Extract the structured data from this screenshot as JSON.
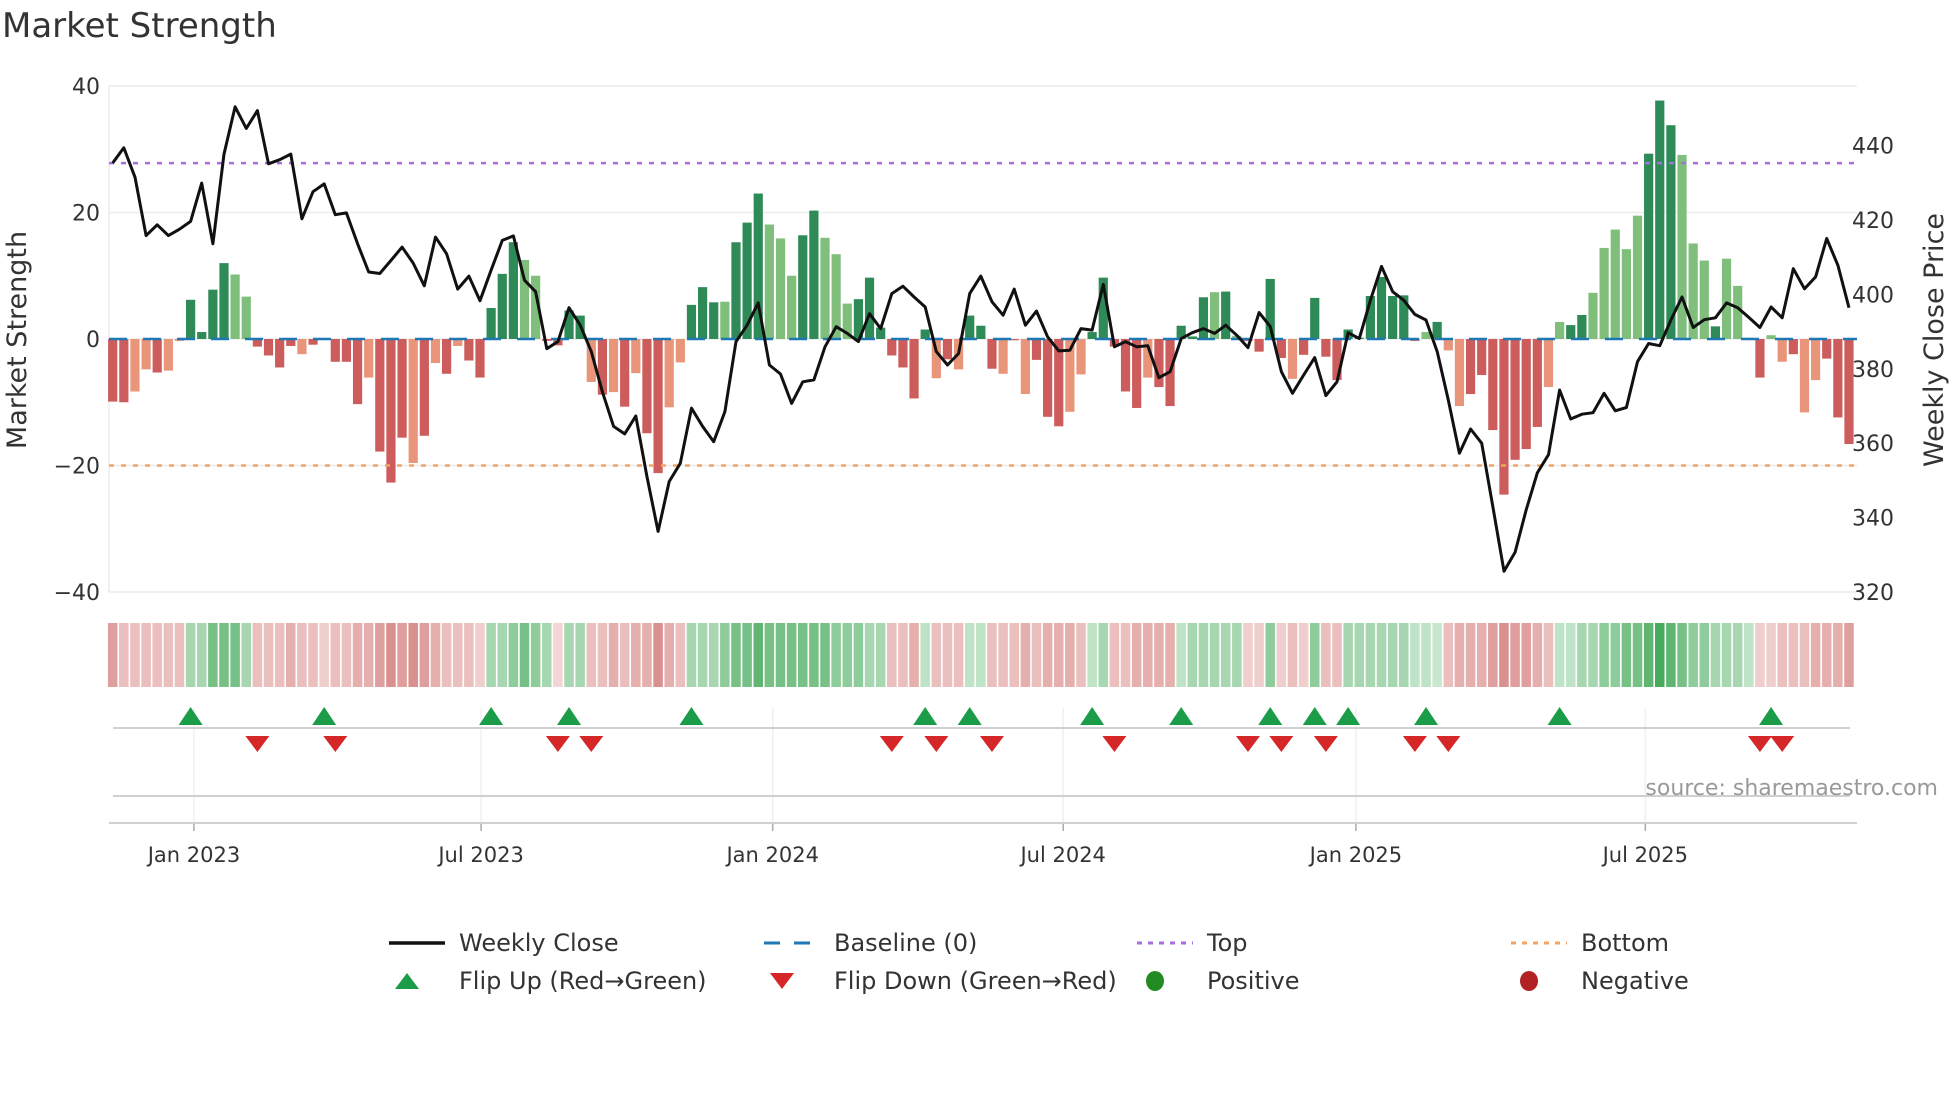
{
  "chart_data": {
    "type": "bar",
    "title": "Market Strength",
    "ylabel": "Market Strength",
    "y2label": "Weekly Close Price",
    "ylim": [
      -40,
      40
    ],
    "y2lim": [
      320,
      456
    ],
    "yticks": [
      "40",
      "20",
      "0",
      "−20",
      "−40"
    ],
    "ytick_values": [
      40,
      20,
      0,
      -20,
      -40
    ],
    "y2ticks": [
      440,
      420,
      400,
      380,
      360,
      340,
      320
    ],
    "top_level": 27.8,
    "bottom_level": -20,
    "baseline": 0,
    "x_ticks": [
      {
        "label": "Jan 2023",
        "week": 7.3
      },
      {
        "label": "Jul 2023",
        "week": 33.1
      },
      {
        "label": "Jan 2024",
        "week": 59.3
      },
      {
        "label": "Jul 2024",
        "week": 85.4
      },
      {
        "label": "Jan 2025",
        "week": 111.7
      },
      {
        "label": "Jul 2025",
        "week": 137.7
      }
    ],
    "strength": [
      -9.9,
      -10,
      -8.3,
      -4.8,
      -5.3,
      -5,
      -0.3,
      6.2,
      1.1,
      7.8,
      12,
      10.2,
      6.7,
      -1.2,
      -2.6,
      -4.5,
      -1.1,
      -2.4,
      -0.9,
      0.1,
      -3.6,
      -3.6,
      -10.3,
      -6.1,
      -17.8,
      -22.7,
      -15.6,
      -19.6,
      -15.3,
      -3.8,
      -5.5,
      -1.1,
      -3.4,
      -6.1,
      4.9,
      10.3,
      15.3,
      12.5,
      10,
      -0.3,
      -1,
      4.5,
      3.7,
      -6.8,
      -8.8,
      -8.4,
      -10.7,
      -5.4,
      -14.9,
      -21.2,
      -10.8,
      -3.7,
      5.4,
      8.2,
      5.8,
      5.9,
      15.3,
      18.4,
      23,
      18.1,
      15.9,
      10,
      16.4,
      20.3,
      16,
      13.4,
      5.6,
      6.3,
      9.7,
      1.8,
      -2.6,
      -4.5,
      -9.4,
      1.5,
      -6.2,
      -3.2,
      -4.8,
      3.7,
      2.1,
      -4.7,
      -5.5,
      -0.2,
      -8.7,
      -3.3,
      -12.3,
      -13.8,
      -11.5,
      -5.6,
      1.1,
      9.7,
      -1.2,
      -8.3,
      -10.9,
      -6.1,
      -7.6,
      -10.6,
      2.1,
      0.4,
      6.6,
      7.4,
      7.5,
      0.5,
      -0.3,
      -2,
      9.5,
      -3,
      -6.3,
      -2.5,
      6.5,
      -2.8,
      -6.5,
      1.5,
      0.2,
      6.8,
      9.8,
      6.8,
      6.9,
      -0.3,
      1.1,
      2.7,
      -1.8,
      -10.6,
      -8.7,
      -5.7,
      -14.4,
      -24.6,
      -19.1,
      -17.4,
      -13.9,
      -7.6,
      2.7,
      2.2,
      3.8,
      7.3,
      14.4,
      17.3,
      14.2,
      19.5,
      29.3,
      37.7,
      33.8,
      29.1,
      15.1,
      12.4,
      2,
      12.7,
      8.4,
      0.2,
      -6.1,
      0.6,
      -3.6,
      -2.4,
      -11.6,
      -6.5,
      -3.1,
      -12.4,
      -16.6
    ],
    "shade": "ddlldllddddllddddldldddldddldldldddddllddddldldlddlldddldddlllddllldddddddldldddldldddlldddddldddddldlddddldddddddddddldlldddddddllddllllldddllldllldlldllddddddldlllldd",
    "weekly_close": [
      435.3,
      439.4,
      431.5,
      415.8,
      418.7,
      415.8,
      417.5,
      419.6,
      429.9,
      413.6,
      437.7,
      450.4,
      444.6,
      449.4,
      435.1,
      436.2,
      437.7,
      420.3,
      427.6,
      429.7,
      421.4,
      421.9,
      413.6,
      406,
      405.6,
      409.1,
      412.7,
      408.4,
      402.3,
      415.4,
      410.9,
      401.4,
      404.9,
      398.3,
      406.5,
      414.5,
      415.7,
      403.8,
      400.7,
      385.4,
      387.3,
      396.4,
      391.7,
      384.6,
      373.8,
      364.5,
      362.5,
      367.3,
      351.1,
      336.3,
      349.7,
      354.6,
      369.4,
      364.5,
      360.4,
      368.5,
      387.3,
      391.7,
      397.7,
      381,
      378.6,
      370.7,
      376.5,
      377,
      385.9,
      391.3,
      389.5,
      387.3,
      394.8,
      390.8,
      400.2,
      402.2,
      399.3,
      396.6,
      384.6,
      381,
      384.1,
      400.2,
      404.9,
      398,
      394.4,
      401.4,
      391.7,
      395.5,
      388.6,
      384.8,
      385,
      390.8,
      390.4,
      402.7,
      385.9,
      387.3,
      385.9,
      386.2,
      377.6,
      379.2,
      388.1,
      389.7,
      390.8,
      389.5,
      391.7,
      389,
      385.7,
      395.1,
      391.4,
      379.2,
      373.4,
      378.3,
      383,
      372.8,
      376.5,
      389.7,
      388.1,
      398.4,
      407.5,
      400.7,
      398.4,
      394.6,
      393.1,
      384.6,
      371.6,
      357.3,
      363.8,
      360,
      343,
      325.6,
      330.7,
      342.1,
      352,
      356.9,
      374.3,
      366.5,
      367.8,
      368.2,
      373.4,
      368.7,
      369.6,
      381.9,
      386.8,
      386.2,
      393.1,
      399.3,
      391.1,
      393.2,
      393.7,
      397.7,
      396.4,
      393.8,
      391.1,
      396.6,
      393.7,
      406.9,
      401.5,
      404.7,
      415,
      407.8,
      396.4
    ],
    "heat": [
      -2,
      -1,
      -1,
      -1,
      -1,
      -1,
      -1,
      1,
      1,
      2,
      2,
      2,
      1,
      -1,
      -1,
      -1,
      -1.5,
      -1,
      -1,
      -0.5,
      -1,
      -1,
      -1.5,
      -1.5,
      -2,
      -2.5,
      -2,
      -2.5,
      -2,
      -1.5,
      -1,
      -1,
      -1,
      -0.5,
      1,
      1,
      1.5,
      2,
      1.5,
      1,
      -0.3,
      1,
      1,
      -1,
      -1,
      -1.5,
      -1,
      -1.5,
      -1.5,
      -2.5,
      -1.5,
      -1,
      1,
      1,
      1,
      1.5,
      2,
      2,
      2.5,
      2,
      2,
      2,
      2,
      2,
      2,
      1.5,
      1.5,
      1.5,
      1,
      1,
      -1,
      -1,
      -1.5,
      0.5,
      -1,
      -1,
      -1,
      0.5,
      0.5,
      -1,
      -1,
      -1,
      -1.5,
      -1,
      -1.5,
      -1.5,
      -1.5,
      -1,
      0.5,
      1,
      -1,
      -1,
      -1.5,
      -1.5,
      -1.5,
      -1.5,
      0.5,
      1,
      1,
      1,
      1,
      1,
      -0.5,
      -0.5,
      1.5,
      -0.5,
      -1,
      -0.5,
      1.5,
      -1,
      -1,
      1,
      1,
      1,
      1,
      1,
      1,
      0.5,
      0.5,
      0.3,
      -1,
      -1.5,
      -1.5,
      -1.5,
      -2,
      -2.5,
      -2,
      -2,
      -1.5,
      -1,
      0.5,
      0.5,
      1,
      1,
      1.5,
      1.5,
      2,
      2,
      2.5,
      3,
      2.5,
      2,
      1.5,
      1.5,
      1,
      1,
      1,
      0.5,
      -0.5,
      -0.5,
      -1,
      -1,
      -1,
      -1.5,
      -1.5,
      -1.5,
      -2
    ],
    "flip_up_weeks": [
      7,
      19,
      34,
      41,
      52,
      73,
      77,
      88,
      96,
      104,
      108,
      111,
      118,
      130,
      149
    ],
    "flip_down_weeks": [
      13,
      20,
      40,
      43,
      70,
      74,
      79,
      90,
      102,
      105,
      109,
      117,
      120,
      148,
      150
    ],
    "legend": [
      {
        "label": "Weekly Close",
        "kind": "line"
      },
      {
        "label": "Baseline (0)",
        "kind": "dash"
      },
      {
        "label": "Top",
        "kind": "dot-top"
      },
      {
        "label": "Bottom",
        "kind": "dot-bottom"
      },
      {
        "label": "Flip Up (Red→Green)",
        "kind": "up"
      },
      {
        "label": "Flip Down (Green→Red)",
        "kind": "down"
      },
      {
        "label": "Positive",
        "kind": "pos"
      },
      {
        "label": "Negative",
        "kind": "neg"
      }
    ],
    "legend_placement": "bottom",
    "source": "source: sharemaestro.com",
    "colors": {
      "pos_dark": "#2e8a57",
      "pos_light": "#7fbf7b",
      "neg_dark": "#cd5c5c",
      "neg_light": "#e8957a",
      "line": "#111111",
      "baseline": "#1f77b4",
      "top": "#a66ee0",
      "bottom": "#f4a460",
      "flip_up": "#1a9c48",
      "flip_down": "#d62728",
      "positive": "#228b22",
      "negative": "#b22222"
    }
  }
}
